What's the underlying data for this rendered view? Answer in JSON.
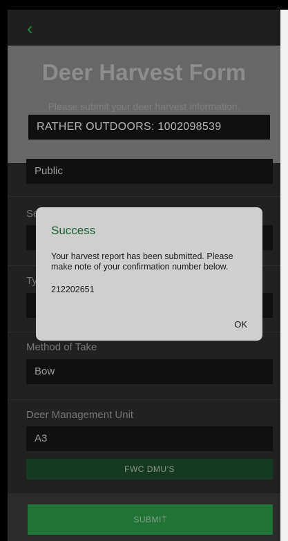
{
  "nav": {
    "back_icon": "chevron-left-icon"
  },
  "header": {
    "title": "Deer Harvest Form",
    "subtitle": "Please submit your deer harvest information.",
    "license": "RATHER OUTDOORS: 1002098539"
  },
  "fields": {
    "land_type_value": "Public",
    "season_label_partial": "Se",
    "type_label_partial": "Ty",
    "method_label": "Method of Take",
    "method_value": "Bow",
    "dmu_label": "Deer Management Unit",
    "dmu_value": "A3"
  },
  "buttons": {
    "dmu_link": "FWC DMU'S",
    "submit": "SUBMIT"
  },
  "dialog": {
    "title": "Success",
    "message": "Your harvest report has been submitted. Please make note of your confirmation number below.",
    "confirmation": "212202651",
    "ok": "OK"
  },
  "colors": {
    "accent": "#2fae4f",
    "submit_bg": "#2d9a4a",
    "dmu_bg": "#1f4d2c"
  }
}
